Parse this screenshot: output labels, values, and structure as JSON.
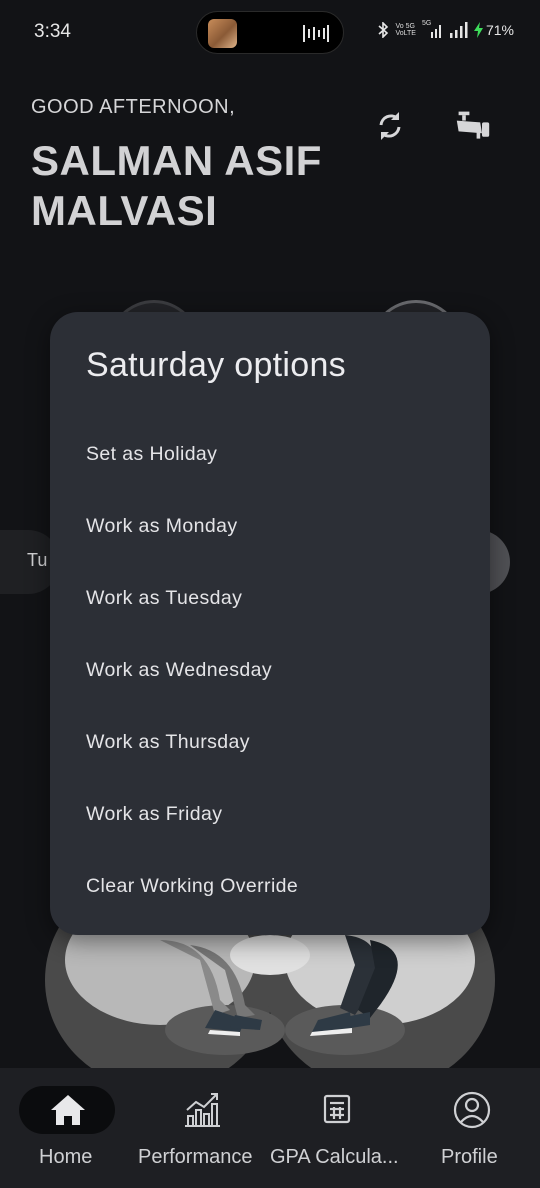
{
  "status_bar": {
    "time": "3:34",
    "battery": "71%",
    "net_top": "Vo 5G",
    "net_bottom": "VoLTE",
    "signal_label": "5G"
  },
  "header": {
    "greeting": "GOOD AFTERNOON,",
    "user_name": "SALMAN ASIF MALVASI"
  },
  "background": {
    "day_chip_text": "Tu"
  },
  "dialog": {
    "title": "Saturday options",
    "options": [
      "Set as Holiday",
      "Work as Monday",
      "Work as Tuesday",
      "Work as Wednesday",
      "Work as Thursday",
      "Work as Friday",
      "Clear Working Override"
    ]
  },
  "bottom_nav": {
    "items": [
      {
        "label": "Home",
        "icon": "home-icon",
        "active": true
      },
      {
        "label": "Performance",
        "icon": "chart-icon",
        "active": false
      },
      {
        "label": "GPA Calcula...",
        "icon": "calculator-icon",
        "active": false
      },
      {
        "label": "Profile",
        "icon": "profile-icon",
        "active": false
      }
    ]
  },
  "colors": {
    "background": "#121316",
    "dialog": "#2c2f36",
    "nav_bar": "#1e1f23",
    "text": "#e4e4e7",
    "battery_bolt": "#3ddc5a"
  }
}
